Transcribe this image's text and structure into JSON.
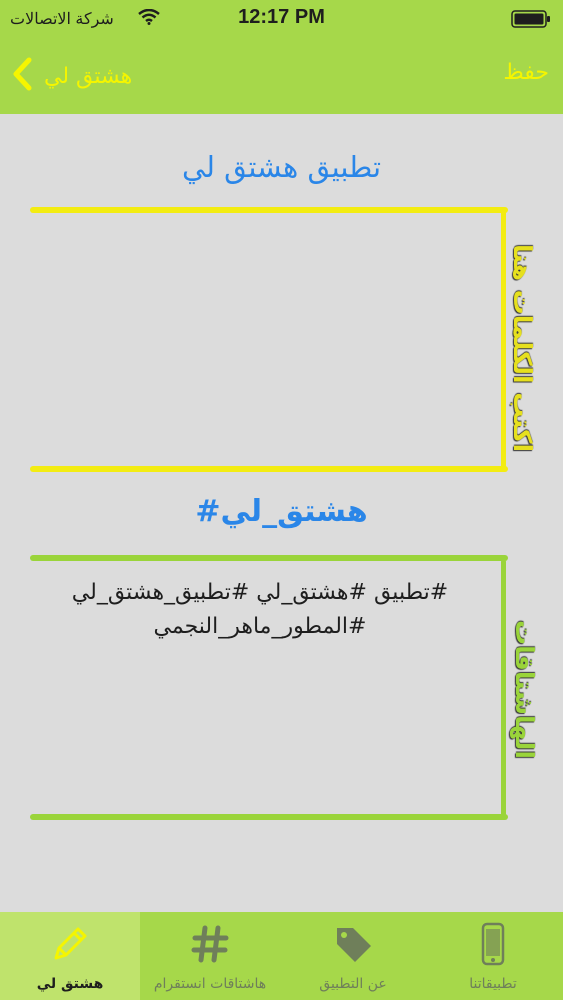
{
  "status_bar": {
    "carrier": "شركة الاتصالات",
    "time": "12:17 PM"
  },
  "nav": {
    "back_title": "هشتق لي",
    "save_label": "حفظ"
  },
  "main": {
    "app_title": "تطبيق هشتق لي",
    "words_label": "اكتب الكلمات هنا",
    "generate_label": "#هشتق_لي",
    "hashtags_label": "الهاشتاقات",
    "result_line1": "#تطبيق #هشتق_لي #تطبيق_هشتق_لي",
    "result_line2": "#المطور_ماهر_النجمي"
  },
  "tabs": [
    {
      "label": "هشتق لي",
      "icon": "pencil-icon",
      "active": true
    },
    {
      "label": "هاشتاقات انستقرام",
      "icon": "hash-icon",
      "active": false
    },
    {
      "label": "عن التطبيق",
      "icon": "tag-icon",
      "active": false
    },
    {
      "label": "تطبيقاتنا",
      "icon": "phone-icon",
      "active": false
    }
  ],
  "colors": {
    "bar_green": "#a6d84a",
    "accent_yellow": "#f5f500",
    "accent_blue": "#2a86e8",
    "background": "#dcdcdc"
  }
}
